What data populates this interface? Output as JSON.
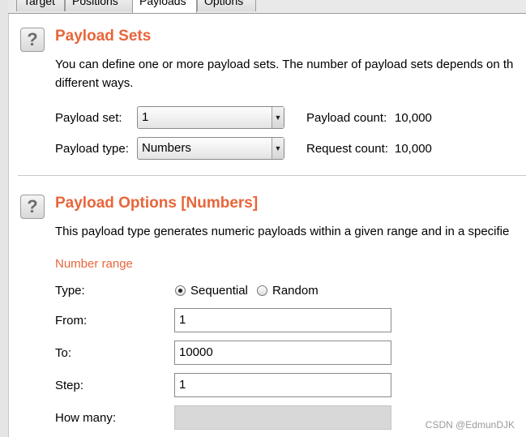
{
  "tabs": [
    {
      "label": "Target"
    },
    {
      "label": "Positions"
    },
    {
      "label": "Payloads"
    },
    {
      "label": "Options"
    }
  ],
  "payload_sets": {
    "title": "Payload Sets",
    "description_line1": "You can define one or more payload sets. The number of payload sets depends on th",
    "description_line2": "different ways.",
    "payload_set_label": "Payload set:",
    "payload_set_value": "1",
    "payload_type_label": "Payload type:",
    "payload_type_value": "Numbers",
    "payload_count_label": "Payload count:",
    "payload_count_value": "10,000",
    "request_count_label": "Request count:",
    "request_count_value": "10,000"
  },
  "payload_options": {
    "title": "Payload Options [Numbers]",
    "description": "This payload type generates numeric payloads within a given range and in a specifie",
    "number_range_heading": "Number range",
    "type_label": "Type:",
    "type_options": [
      "Sequential",
      "Random"
    ],
    "type_selected": "Sequential",
    "from_label": "From:",
    "from_value": "1",
    "to_label": "To:",
    "to_value": "10000",
    "step_label": "Step:",
    "step_value": "1",
    "how_many_label": "How many:",
    "how_many_value": ""
  },
  "icons": {
    "help_glyph": "?",
    "dropdown_glyph": "▼"
  },
  "watermark": "CSDN @EdmunDJK",
  "colors": {
    "accent": "#e8653a",
    "background": "#ffffff"
  }
}
